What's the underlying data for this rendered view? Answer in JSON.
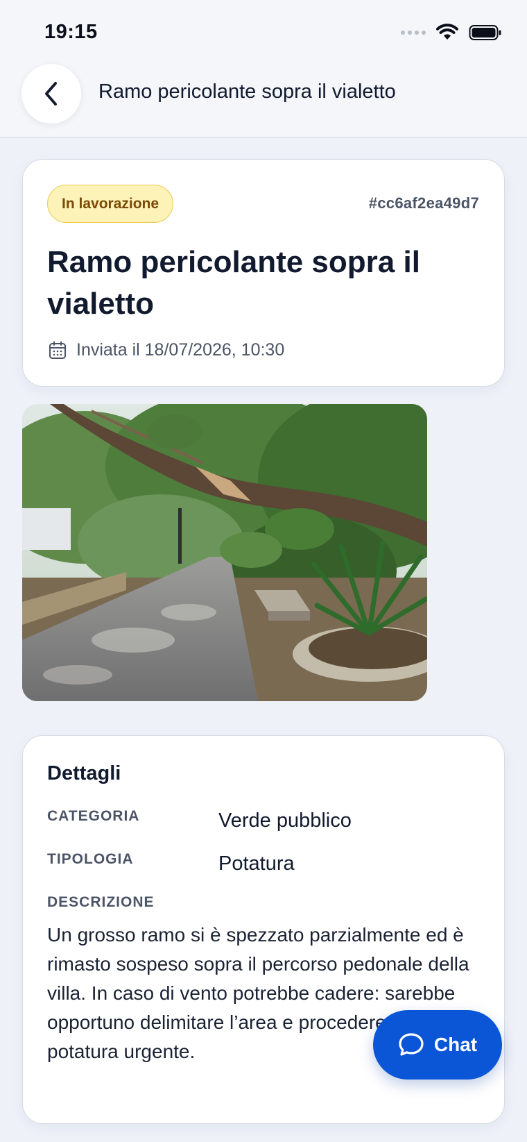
{
  "status_bar": {
    "time": "19:15"
  },
  "header": {
    "title": "Ramo pericolante sopra il vialetto",
    "back_icon": "chevron-left-icon"
  },
  "report": {
    "status": "In lavorazione",
    "status_colors": {
      "bg": "#fdf2b8",
      "border": "#eacc55",
      "text": "#7a4a06"
    },
    "id": "#cc6af2ea49d7",
    "title": "Ramo pericolante sopra il vialetto",
    "sent_at": "Inviata il 18/07/2026, 10:30",
    "sent_icon": "calendar-icon"
  },
  "photo": {
    "subject": "broken-branch-over-park-path"
  },
  "details": {
    "title": "Dettagli",
    "fields": [
      {
        "label": "CATEGORIA",
        "value": "Verde pubblico"
      },
      {
        "label": "TIPOLOGIA",
        "value": "Potatura"
      }
    ],
    "description_label": "DESCRIZIONE",
    "description": "Un grosso ramo si è spezzato parzialmente ed è rimasto sospeso sopra il percorso pedonale della villa. In caso di vento potrebbe cadere: sarebbe opportuno delimitare l’area e procedere con una potatura urgente."
  },
  "chat": {
    "label": "Chat",
    "icon": "chat-bubble-icon",
    "color": "#0a56d6"
  }
}
